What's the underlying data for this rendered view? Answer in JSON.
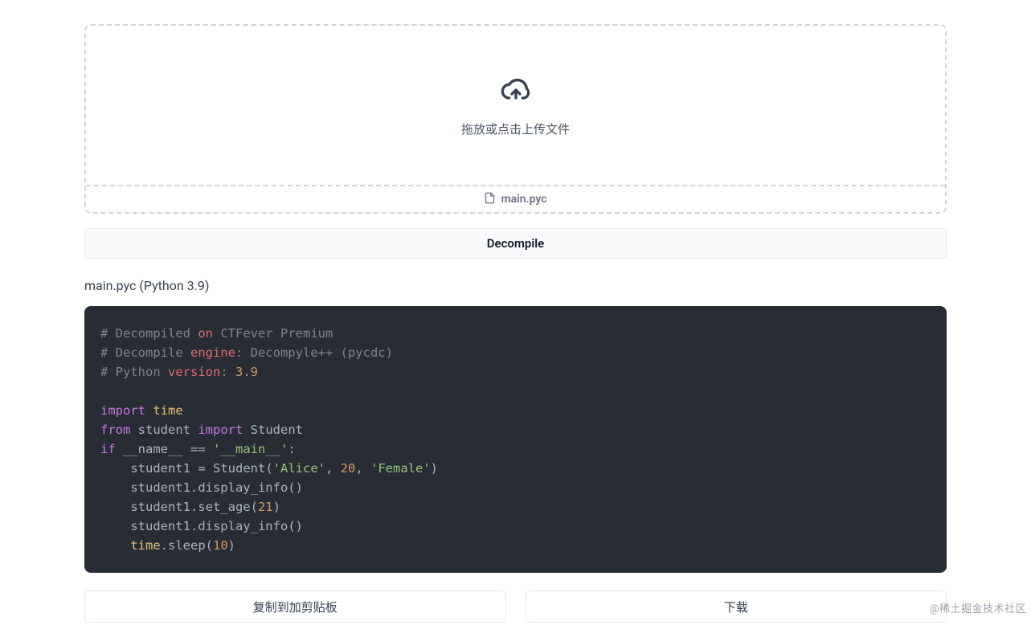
{
  "dropzone": {
    "prompt": "拖放或点击上传文件",
    "filename": "main.pyc"
  },
  "decompile_button": "Decompile",
  "result": {
    "title": "main.pyc (Python 3.9)",
    "code": {
      "line1_a": "# Decompiled ",
      "line1_b": "on",
      "line1_c": " CTFever Premium",
      "line2_a": "# Decompile ",
      "line2_b": "engine",
      "line2_c": ": Decompyle++ (pycdc)",
      "line3_a": "# Python ",
      "line3_b": "version",
      "line3_c": ": ",
      "line3_d": "3.9",
      "line5_a": "import",
      "line5_b": " time",
      "line6_a": "from",
      "line6_b": " student ",
      "line6_c": "import",
      "line6_d": " Student",
      "line7_a": "if",
      "line7_b": " __name__ ",
      "line7_c": "==",
      "line7_d": " ",
      "line7_e": "'__main__'",
      "line7_f": ":",
      "line8_a": "    student1 ",
      "line8_b": "=",
      "line8_c": " Student(",
      "line8_d": "'Alice'",
      "line8_e": ", ",
      "line8_f": "20",
      "line8_g": ", ",
      "line8_h": "'Female'",
      "line8_i": ")",
      "line9": "    student1.display_info()",
      "line10_a": "    student1.set_age(",
      "line10_b": "21",
      "line10_c": ")",
      "line11": "    student1.display_info()",
      "line12_a": "    ",
      "line12_b": "time",
      "line12_c": ".sleep(",
      "line12_d": "10",
      "line12_e": ")"
    }
  },
  "actions": {
    "copy": "复制到加剪贴板",
    "download": "下载"
  },
  "watermark": "@稀土掘金技术社区"
}
